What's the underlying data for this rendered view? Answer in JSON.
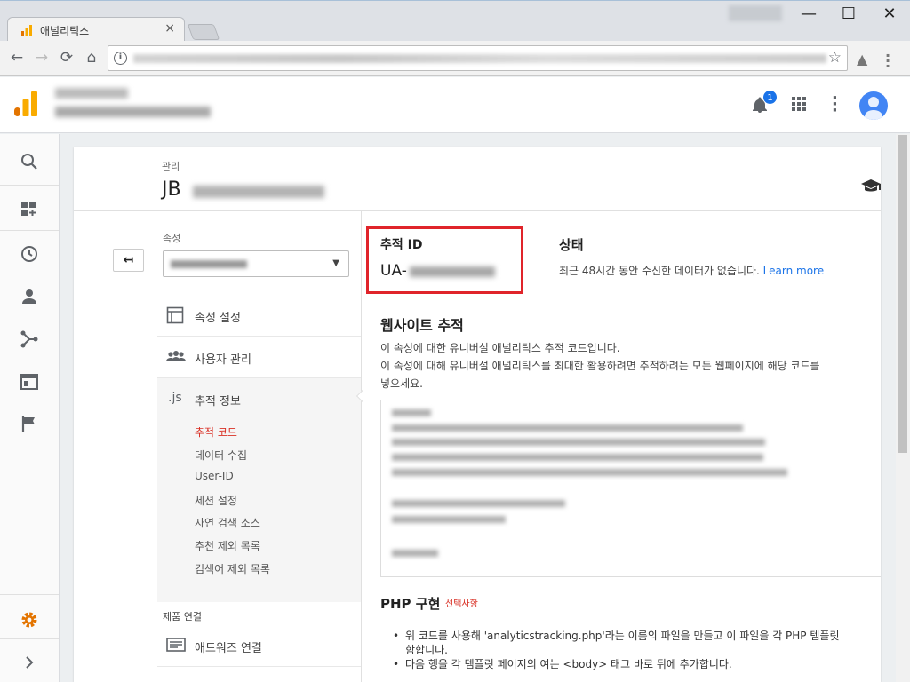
{
  "browser": {
    "tab_title": "애널리틱스",
    "tab_close": "×",
    "win_minimize": "—",
    "win_maximize": "☐",
    "win_close": "✕"
  },
  "header": {
    "notification_count": "1"
  },
  "page": {
    "breadcrumb": "관리",
    "title_prefix": "JB"
  },
  "left_panel": {
    "property_label": "속성",
    "menu": [
      {
        "label": "속성 설정"
      },
      {
        "label": "사용자 관리"
      },
      {
        "label": "추적 정보"
      }
    ],
    "js_badge": ".js",
    "sub_items": [
      "추적 코드",
      "데이터 수집",
      "User-ID",
      "세션 설정",
      "자연 검색 소스",
      "추천 제외 목록",
      "검색어 제외 목록"
    ],
    "product_section": "제품 연결",
    "adwords_link": "애드워즈 연결"
  },
  "content": {
    "tracking_id_label": "추적 ID",
    "tracking_id_prefix": "UA-",
    "status_label": "상태",
    "status_text": "최근 48시간 동안 수신한 데이터가 없습니다.",
    "learn_more": "Learn more",
    "website_tracking_title": "웹사이트 추적",
    "desc_line1": "이 속성에 대한 유니버설 애널리틱스 추적 코드입니다.",
    "desc_line2": "이 속성에 대해 유니버설 애널리틱스를 최대한 활용하려면 추적하려는 모든 웹페이지에 해당 코드를",
    "desc_line3": "넣으세요.",
    "php_title": "PHP 구현",
    "php_optional": "선택사항",
    "bullet1a": "위 코드를 사용해 'analyticstracking.php'라는 이름의 파일을 만들고 이 파일을 각 PHP 템플릿",
    "bullet1b": "함합니다.",
    "bullet2": "다음 행을 각 템플릿 페이지의 여는 <body> 태그 바로 뒤에 추가합니다."
  },
  "colors": {
    "accent": "#1a73e8",
    "active_red": "#d93025",
    "highlight_box": "#e0242a",
    "ga_orange": "#f9ab00",
    "ga_dark_orange": "#e37400"
  }
}
